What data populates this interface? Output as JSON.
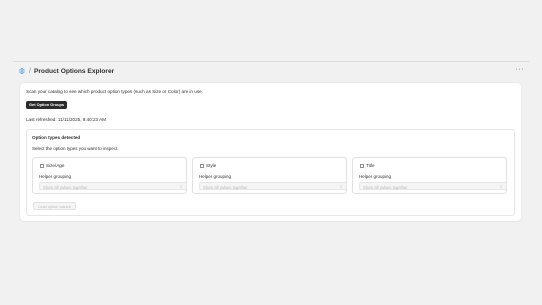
{
  "header": {
    "title": "Product Options Explorer",
    "separator": "/",
    "more_label": "···"
  },
  "main": {
    "description": "Scan your catalog to see which product option types (such as Size or Color) are in use.",
    "get_groups_label": "Get Option Groups",
    "last_refreshed": "Last refreshed: 11/11/2025, 9:40:23 AM",
    "options_section": {
      "title": "Option types detected",
      "subtitle": "Select the option types you want to inspect.",
      "options": [
        {
          "label": "Size/Age",
          "checked": false,
          "helper_label": "Helper grouping",
          "select_value": "Show all values together"
        },
        {
          "label": "Style",
          "checked": false,
          "helper_label": "Helper grouping",
          "select_value": "Show all values together"
        },
        {
          "label": "Title",
          "checked": false,
          "helper_label": "Helper grouping",
          "select_value": "Show all values together"
        }
      ],
      "load_button_label": "Load option values"
    }
  },
  "colors": {
    "background": "#f1f1f1",
    "primary_button": "#2b2b2b",
    "app_icon": "#4a90c8"
  }
}
